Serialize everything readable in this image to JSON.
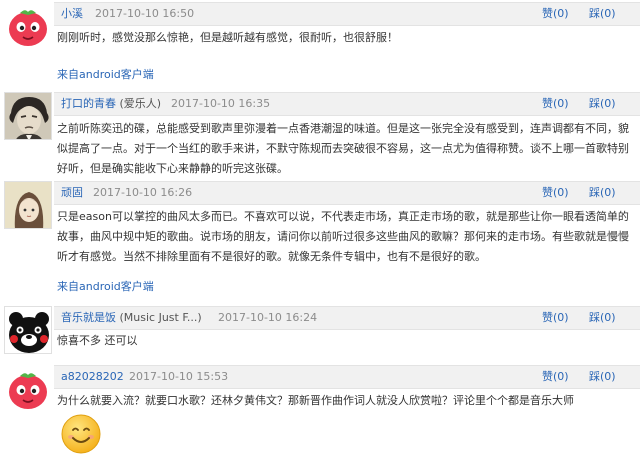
{
  "comments": [
    {
      "username": "小溪",
      "tag": "",
      "date": "2017-10-10 16:50",
      "like_label": "赞(0)",
      "dislike_label": "踩(0)",
      "text": "刚刚听时，感觉没那么惊艳，但是越听越有感觉，很耐听，也很舒服！",
      "source": "来自android客户端",
      "avatar": "red-tomato-face-icon"
    },
    {
      "username": "打口的青春",
      "tag": "(爱乐人)",
      "date": "2017-10-10 16:35",
      "like_label": "赞(0)",
      "dislike_label": "踩(0)",
      "text": "之前听陈奕迅的碟，总能感受到歌声里弥漫着一点香港潮湿的味道。但是这一张完全没有感受到，连声调都有不同，貌似提高了一点。对于一个当红的歌手来讲，不默守陈规而去突破很不容易，这一点尤为值得称赞。谈不上哪一首歌特别好听，但是确实能收下心来静静的听完这张碟。",
      "source": "",
      "avatar": "beethoven-portrait-icon"
    },
    {
      "username": "顽固",
      "tag": "",
      "date": "2017-10-10 16:26",
      "like_label": "赞(0)",
      "dislike_label": "踩(0)",
      "text": "只是eason可以掌控的曲风太多而已。不喜欢可以说，不代表走市场，真正走市场的歌，就是那些让你一眼看透简单的故事，曲风中规中矩的歌曲。说市场的朋友，请问你以前听过很多这些曲风的歌嘛？那何来的走市场。有些歌就是慢慢听才有感觉。当然不排除里面有不是很好的歌。就像无条件专辑中，也有不是很好的歌。",
      "source": "来自android客户端",
      "avatar": "anime-girl-icon"
    },
    {
      "username": "音乐就是饭",
      "tag": "(Music Just F...)",
      "date": "2017-10-10 16:24",
      "like_label": "赞(0)",
      "dislike_label": "踩(0)",
      "text": "惊喜不多 还可以",
      "source": "",
      "avatar": "kumamon-bear-icon"
    },
    {
      "username": "a82028202",
      "tag": "",
      "date": "2017-10-10 15:53",
      "like_label": "赞(0)",
      "dislike_label": "踩(0)",
      "text": "为什么就要入流？就要口水歌？还林夕黄伟文？那新晋作曲作词人就没人欣赏啦？评论里个个都是音乐大师",
      "source": "",
      "avatar": "red-tomato-face-icon",
      "emoji": "smiley-face-icon"
    }
  ]
}
